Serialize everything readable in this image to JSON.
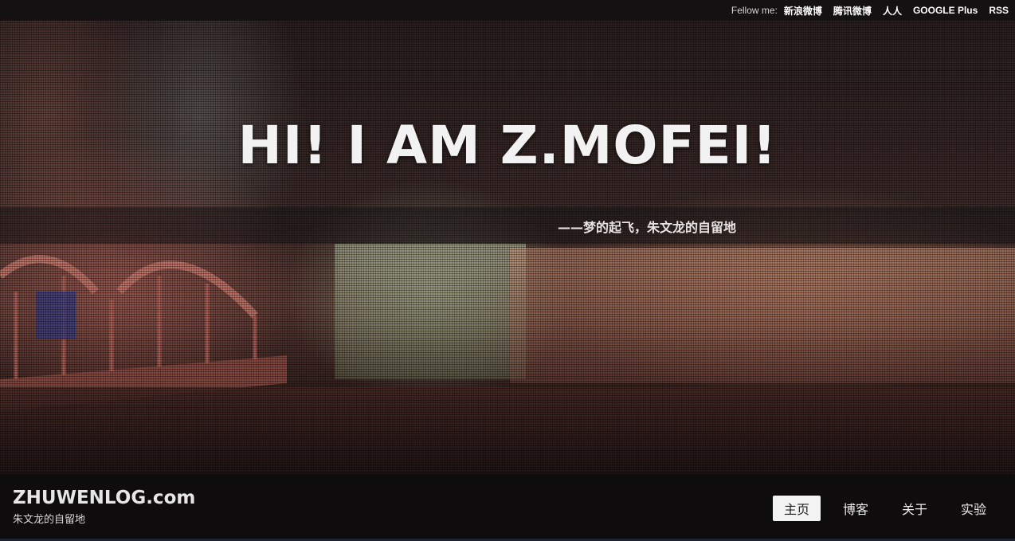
{
  "topbar": {
    "follow_label": "Fellow me:",
    "links": [
      "新浪微博",
      "腾讯微博",
      "人人",
      "GOOGLE Plus",
      "RSS"
    ]
  },
  "hero": {
    "title": "HI! I AM Z.MOFEI!",
    "subtitle": "——梦的起飞，朱文龙的自留地"
  },
  "footer": {
    "site_name": "ZHUWENLOG.com",
    "tagline": "朱文龙的自留地",
    "nav": [
      "主页",
      "博客",
      "关于",
      "实验"
    ],
    "active_nav": "主页"
  },
  "colors": {
    "topbar_bg": "#141112",
    "footer_bg": "#0f0c0d",
    "active_nav_bg": "#f3f3f3"
  }
}
